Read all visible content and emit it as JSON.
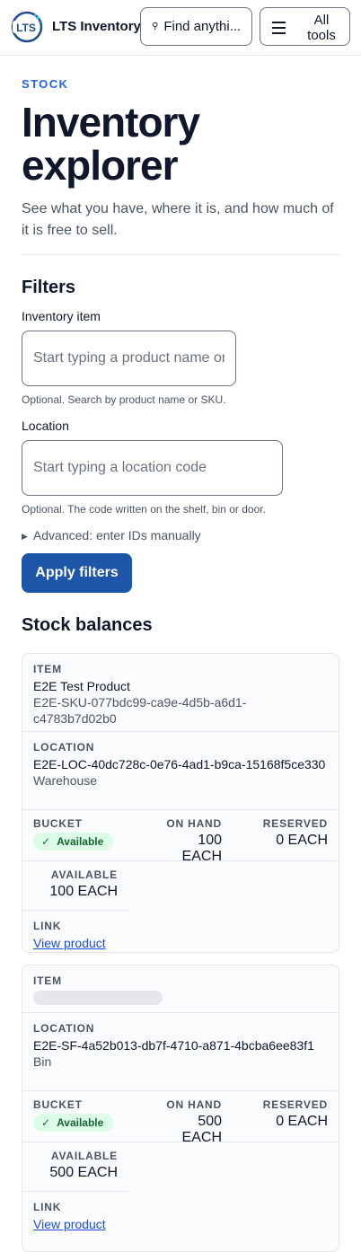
{
  "header": {
    "brand": "LTS Inventory",
    "logo_text": "LTS",
    "search_label": "Find anythi...",
    "tools_label": "All tools"
  },
  "page": {
    "eyebrow": "STOCK",
    "title": "Inventory explorer",
    "lead": "See what you have, where it is, and how much of it is free to sell."
  },
  "filters": {
    "heading": "Filters",
    "item_label": "Inventory item",
    "item_placeholder": "Start typing a product name or SKU",
    "item_hint": "Optional. Search by product name or SKU.",
    "location_label": "Location",
    "location_placeholder": "Start typing a location code",
    "location_hint": "Optional. The code written on the shelf, bin or door.",
    "advanced": "Advanced: enter IDs manually",
    "apply": "Apply filters"
  },
  "balances": {
    "heading": "Stock balances",
    "captions": {
      "item": "ITEM",
      "location": "LOCATION",
      "bucket": "BUCKET",
      "on_hand": "ON HAND",
      "reserved": "RESERVED",
      "available": "AVAILABLE",
      "link": "LINK"
    },
    "rows": [
      {
        "item_name": "E2E Test Product",
        "item_sku": "E2E-SKU-077bdc99-ca9e-4d5b-a6d1-c4783b7d02b0",
        "location_code": "E2E-LOC-40dc728c-0e76-4ad1-b9ca-15168f5ce330",
        "location_type": "Warehouse",
        "bucket": "Available",
        "on_hand": "100 EACH",
        "reserved": "0 EACH",
        "available": "100 EACH",
        "link": "View product"
      },
      {
        "item_name": "",
        "item_sku": "",
        "location_code": "E2E-SF-4a52b013-db7f-4710-a871-4bcba6ee83f1",
        "location_type": "Bin",
        "bucket": "Available",
        "on_hand": "500 EACH",
        "reserved": "0 EACH",
        "available": "500 EACH",
        "link": "View product"
      }
    ]
  },
  "colors": {
    "accent": "#1d56a8",
    "eyebrow": "#2563eb",
    "badge_bg": "#dcfce7",
    "badge_fg": "#166534"
  }
}
